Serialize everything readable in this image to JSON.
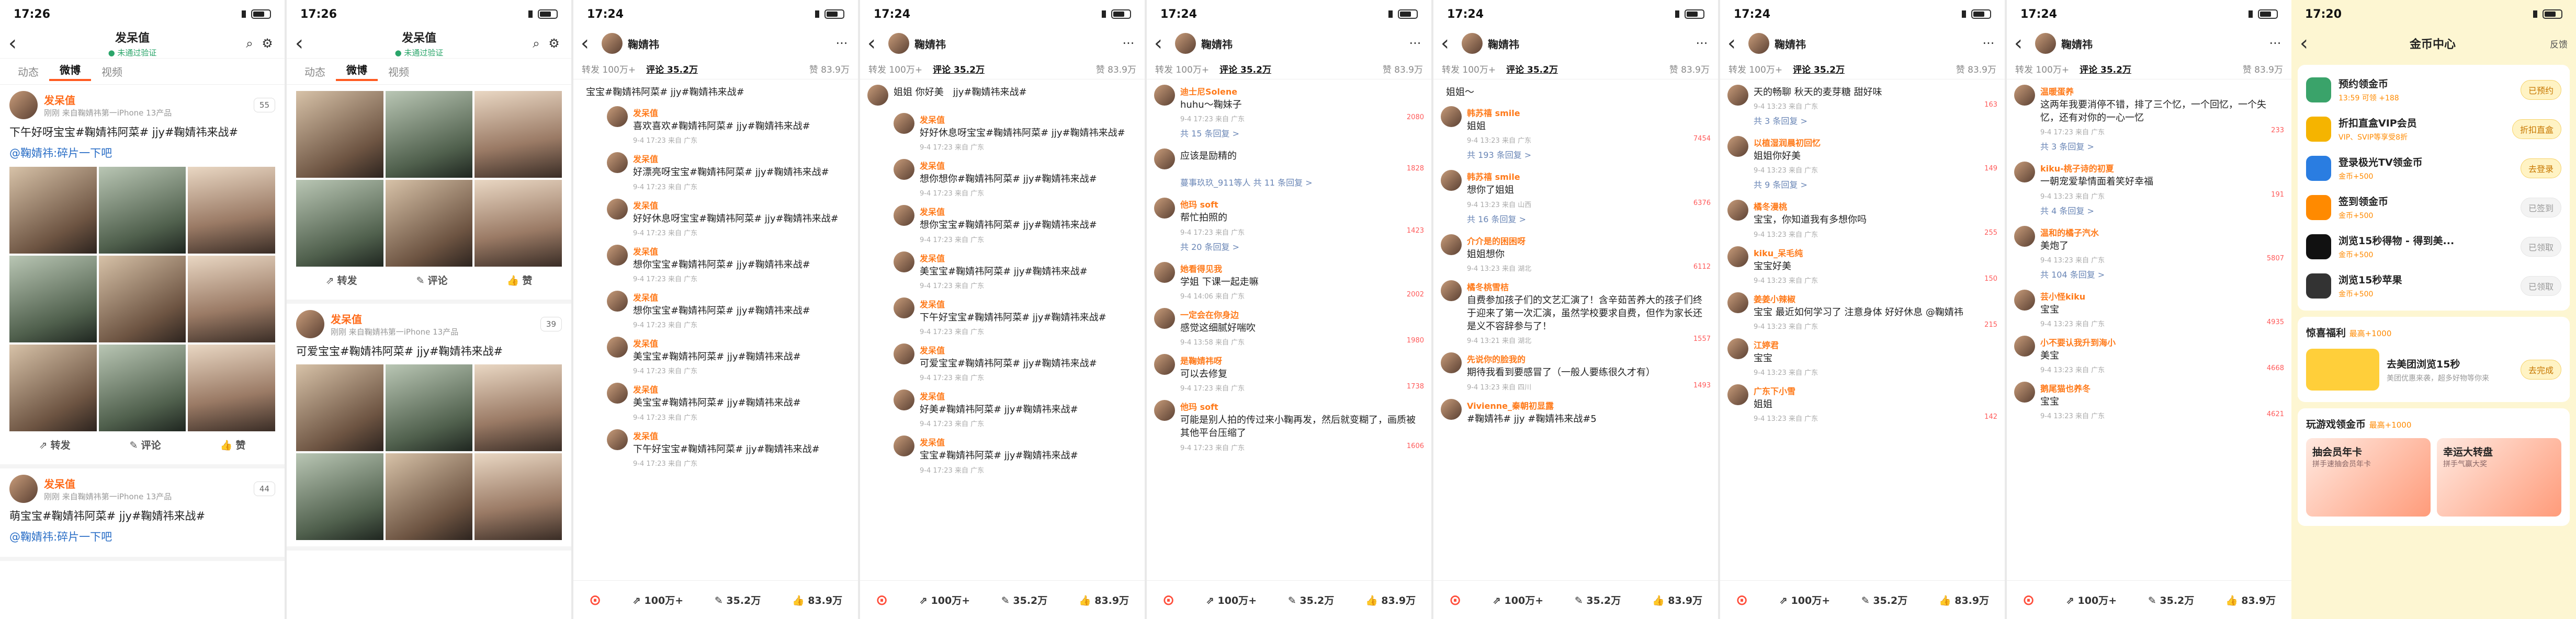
{
  "s1": {
    "time": "17:26",
    "title": "发呆值",
    "sub": "● 未通过验证",
    "tabs": [
      "动态",
      "微博",
      "视频"
    ],
    "post1": {
      "name": "发呆值",
      "src": "刚刚  来自鞠婧祎第一iPhone 13产品",
      "follow": "55",
      "text": "下午好呀宝宝#鞠婧祎阿菜# jjy#鞠婧祎来战#",
      "fwd": "@鞠婧祎:碎片一下吧"
    },
    "acts": [
      "转发",
      "评论",
      "赞"
    ],
    "post2": {
      "name": "发呆值",
      "src": "刚刚  来自鞠婧祎第一iPhone 13产品",
      "follow": "44",
      "text": "萌宝宝#鞠婧祎阿菜# jjy#鞠婧祎来战#",
      "fwd": "@鞠婧祎:碎片一下吧"
    }
  },
  "s2": {
    "time": "17:26",
    "title": "发呆值",
    "sub": "● 未通过验证",
    "tabs": [
      "动态",
      "微博",
      "视频"
    ],
    "acts": [
      "转发",
      "评论",
      "赞"
    ],
    "post": {
      "name": "发呆值",
      "src": "刚刚  来自鞠婧祎第一iPhone 13产品",
      "follow": "39",
      "text": "可爱宝宝#鞠婧祎阿菜# jjy#鞠婧祎来战#"
    }
  },
  "s3": {
    "time": "17:24",
    "user": "鞠婧祎",
    "fwd": "转发 100万+",
    "cmt": "评论 35.2万",
    "like": "赞 83.9万",
    "top": "宝宝#鞠婧祎阿菜# jjy#鞠婧祎来战#",
    "comments": [
      {
        "u": "发呆值",
        "t": "喜欢喜欢#鞠婧祎阿菜# jjy#鞠婧祎来战#",
        "m": "9-4 17:23 来自 广东"
      },
      {
        "u": "发呆值",
        "t": "好漂亮呀宝宝#鞠婧祎阿菜# jjy#鞠婧祎来战#",
        "m": "9-4 17:23 来自 广东"
      },
      {
        "u": "发呆值",
        "t": "好好休息呀宝宝#鞠婧祎阿菜# jjy#鞠婧祎来战#",
        "m": "9-4 17:23 来自 广东"
      },
      {
        "u": "发呆值",
        "t": "想你宝宝#鞠婧祎阿菜# jjy#鞠婧祎来战#",
        "m": "9-4 17:23 来自 广东"
      },
      {
        "u": "发呆值",
        "t": "想你宝宝#鞠婧祎阿菜# jjy#鞠婧祎来战#",
        "m": "9-4 17:23 来自 广东"
      },
      {
        "u": "发呆值",
        "t": "美宝宝#鞠婧祎阿菜# jjy#鞠婧祎来战#",
        "m": "9-4 17:23 来自 广东"
      },
      {
        "u": "发呆值",
        "t": "美宝宝#鞠婧祎阿菜# jjy#鞠婧祎来战#",
        "m": "9-4 17:23 来自 广东"
      },
      {
        "u": "发呆值",
        "t": "下午好宝宝#鞠婧祎阿菜# jjy#鞠婧祎来战#",
        "m": "9-4 17:23 来自 广东"
      }
    ],
    "bar": [
      "100万+",
      "35.2万",
      "83.9万"
    ]
  },
  "s4": {
    "time": "17:24",
    "user": "鞠婧祎",
    "fwd": "转发 100万+",
    "cmt": "评论 35.2万",
    "like": "赞 83.9万",
    "top": "姐姐 你好美",
    "topR": "jjy#鞠婧祎来战#",
    "comments": [
      {
        "u": "发呆值",
        "t": "好好休息呀宝宝#鞠婧祎阿菜# jjy#鞠婧祎来战#",
        "m": "9-4 17:23 来自 广东"
      },
      {
        "u": "发呆值",
        "t": "想你想你#鞠婧祎阿菜# jjy#鞠婧祎来战#",
        "m": "9-4 17:23 来自 广东"
      },
      {
        "u": "发呆值",
        "t": "想你宝宝#鞠婧祎阿菜# jjy#鞠婧祎来战#",
        "m": "9-4 17:23 来自 广东"
      },
      {
        "u": "发呆值",
        "t": "美宝宝#鞠婧祎阿菜# jjy#鞠婧祎来战#",
        "m": "9-4 17:23 来自 广东"
      },
      {
        "u": "发呆值",
        "t": "下午好宝宝#鞠婧祎阿菜# jjy#鞠婧祎来战#",
        "m": "9-4 17:23 来自 广东"
      },
      {
        "u": "发呆值",
        "t": "可爱宝宝#鞠婧祎阿菜# jjy#鞠婧祎来战#",
        "m": "9-4 17:23 来自 广东"
      },
      {
        "u": "发呆值",
        "t": "好美#鞠婧祎阿菜# jjy#鞠婧祎来战#",
        "m": "9-4 17:23 来自 广东"
      },
      {
        "u": "发呆值",
        "t": "宝宝#鞠婧祎阿菜# jjy#鞠婧祎来战#",
        "m": "9-4 17:23 来自 广东"
      }
    ],
    "bar": [
      "100万+",
      "35.2万",
      "83.9万"
    ]
  },
  "s5": {
    "time": "17:24",
    "user": "鞠婧祎",
    "fwd": "转发 100万+",
    "cmt": "评论 35.2万",
    "like": "赞 83.9万",
    "comments": [
      {
        "u": "迪士尼Solene",
        "t": "huhu～鞠妹子",
        "m": "9-4 17:23 来自 广东",
        "l": "2080"
      },
      {
        "u": "",
        "t": "应该是励精的",
        "m": "",
        "l": "1828"
      },
      {
        "u": "他玛 soft",
        "t": "帮忙拍照的",
        "m": "9-4 17:23 来自 广东",
        "l": "1423"
      },
      {
        "u": "她看得见我",
        "t": "学姐 下课一起走嘛",
        "m": "9-4 14:06 来自 广东",
        "l": "2002"
      },
      {
        "u": "一定会在你身边",
        "t": "感觉这细腻好喘吹",
        "m": "9-4 13:58 来自 广东",
        "l": "1980"
      },
      {
        "u": "是鞠婧祎呀",
        "t": "可以去修复",
        "m": "9-4 17:23 来自 广东",
        "l": "1738"
      },
      {
        "u": "他玛 soft",
        "t": "可能是别人拍的传过来小鞠再发，然后就变糊了，画质被其他平台压缩了",
        "m": "9-4 17:23 来自 广东",
        "l": "1606"
      }
    ],
    "more": [
      "共 15 条回复 >",
      "蔓事玖玖_911等人 共 11 条回复 >",
      "共 20 条回复 >"
    ],
    "bar": [
      "100万+",
      "35.2万",
      "83.9万"
    ]
  },
  "s6": {
    "time": "17:24",
    "user": "鞠婧祎",
    "fwd": "转发 100万+",
    "cmt": "评论 35.2万",
    "like": "赞 83.9万",
    "comments": [
      {
        "u": "韩苏禧 smile",
        "t": "姐姐",
        "m": "9-4 13:23 来自 广东",
        "l": "7454"
      },
      {
        "u": "韩苏禧 smile",
        "t": "想你了姐姐",
        "m": "9-4 13:23 来自 山西",
        "l": "6376"
      },
      {
        "u": "介介是的困困呀",
        "t": "姐姐想你",
        "m": "9-4 13:23 来自 湖北",
        "l": "6112"
      },
      {
        "u": "橘冬桃雪桔",
        "t": "自费参加孩子们的文艺汇演了！含辛茹苦养大的孩子们终于迎来了第一次汇演，虽然学校要求自费，但作为家长还是义不容辞参与了！",
        "m": "9-4 13:21 来自 湖北",
        "l": "1557"
      },
      {
        "u": "先说你的脸我的",
        "t": "期待我看到要感冒了（一般人要练很久才有）",
        "m": "9-4 13:23 来自 四川",
        "l": "1493"
      },
      {
        "u": "Vivienne_秦朝初显露",
        "t": "#鞠婧祎# jjy #鞠婧祎来战#5",
        "m": "",
        "l": ""
      }
    ],
    "more": [
      "共 193 条回复 >",
      "共 16 条回复 >"
    ],
    "top": "姐姐～",
    "bar": [
      "100万+",
      "35.2万",
      "83.9万"
    ]
  },
  "s7": {
    "time": "17:24",
    "user": "鞠婧祎",
    "fwd": "转发 100万+",
    "cmt": "评论 35.2万",
    "like": "赞 83.9万",
    "comments": [
      {
        "u": "",
        "t": "天的畅聊 秋天的麦芽糖 甜好味",
        "m": "9-4 13:23 来自 广东",
        "l": "163"
      },
      {
        "u": "以植湿润晨初回忆",
        "t": "姐姐你好美",
        "m": "9-4 13:23 来自 广东",
        "l": "149"
      },
      {
        "u": "橘冬漫桃",
        "t": "宝宝，你知道我有多想你吗",
        "m": "9-4 13:23 来自 广东",
        "l": "255"
      },
      {
        "u": "kiku_呆毛纯",
        "t": "宝宝好美",
        "m": "9-4 13:23 来自 广东",
        "l": "150"
      },
      {
        "u": "姜姜小辣椒",
        "t": "宝宝 最近如何学习了 注意身体 好好休息 @鞠婧祎",
        "m": "9-4 13:23 来自 广东",
        "l": "215"
      },
      {
        "u": "江婷君",
        "t": "宝宝",
        "m": "9-4 13:23 来自 广东",
        "l": ""
      },
      {
        "u": "广东下小雪",
        "t": "姐姐",
        "m": "9-4 13:23 来自 广东",
        "l": "142"
      }
    ],
    "more": [
      "共 3 条回复 >",
      "共 9 条回复 >"
    ],
    "bar": [
      "100万+",
      "35.2万",
      "83.9万"
    ]
  },
  "s8": {
    "time": "17:24",
    "user": "鞠婧祎",
    "fwd": "转发 100万+",
    "cmt": "评论 35.2万",
    "like": "赞 83.9万",
    "comments": [
      {
        "u": "温暖蛋养",
        "t": "这两年我要消停不错，排了三个忆，一个回忆，一个失忆，还有对你的一心一忆",
        "m": "9-4 17:23 来自 广东",
        "l": "233"
      },
      {
        "u": "kiku-桃子诗的初夏",
        "t": "一朝宠爱挚情面着笑好幸福",
        "m": "9-4 13:23 来自 广东",
        "l": "191"
      },
      {
        "u": "温和的橘子汽水",
        "t": "美炮了",
        "m": "9-4 13:23 来自 广东",
        "l": "5807"
      },
      {
        "u": "芸小怪kiku",
        "t": "宝宝",
        "m": "9-4 13:23 来自 广东",
        "l": "4935"
      },
      {
        "u": "小不要认我升到海小",
        "t": "美宝",
        "m": "9-4 13:23 来自 广东",
        "l": "4668"
      },
      {
        "u": "鹅尾猫也养冬",
        "t": "宝宝",
        "m": "9-4 13:23 来自 广东",
        "l": "4621"
      }
    ],
    "more": [
      "共 3 条回复 >",
      "共 4 条回复 >",
      "共 104 条回复 >"
    ],
    "bar": [
      "100万+",
      "35.2万",
      "83.9万"
    ]
  },
  "s9": {
    "time": "17:20",
    "title": "金币中心",
    "feedback": "反馈",
    "tasks": [
      {
        "n": "预约领金币",
        "d": "13:59 可领 +188",
        "b": "已预约",
        "c": "#3aa36a"
      },
      {
        "n": "折扣直盒VIP会员",
        "d": "VIP、SVIP等享受8折",
        "b": "折扣直盒",
        "c": "#f5b400"
      },
      {
        "n": "登录极光TV领金币",
        "d": "金币+500",
        "b": "去登录",
        "c": "#2a7de1"
      },
      {
        "n": "签到领金币",
        "d": "金币+500",
        "b": "已签到",
        "c": "#ff8a00"
      },
      {
        "n": "浏览15秒得物 - 得到美...",
        "d": "金币+500",
        "b": "已领取",
        "c": "#111"
      },
      {
        "n": "浏览15秒苹果",
        "d": "金币+500",
        "b": "已领取",
        "c": "#333"
      }
    ],
    "surprise": {
      "title": "惊喜福利",
      "bonus": "最高+1000",
      "item": "去美团浏览15秒",
      "desc": "美团优惠来袭，超多好物等你来",
      "btn": "去完成"
    },
    "games": {
      "title": "玩游戏领金币",
      "bonus": "最高+1000",
      "g1": "抽会员年卡",
      "g1s": "拼手速抽会员年卡",
      "g2": "幸运大转盘",
      "g2s": "拼手气赢大奖"
    }
  }
}
